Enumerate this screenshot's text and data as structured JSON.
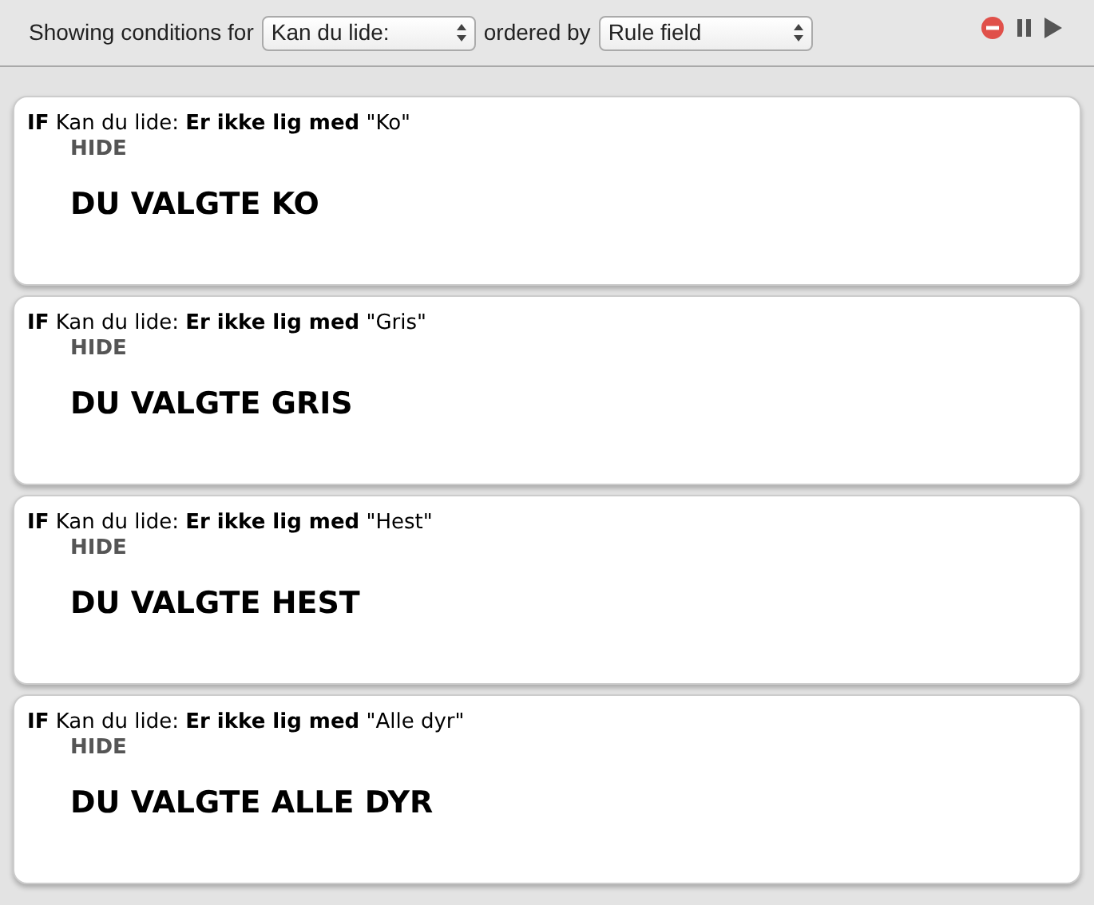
{
  "toolbar": {
    "label": "Showing conditions for",
    "field_select": "Kan du lide:",
    "order_label": "ordered by",
    "order_select": "Rule field"
  },
  "rules": [
    {
      "condition": "**IF** Kan du lide: **Er ikke lig med** \"Ko\"",
      "action": "HIDE",
      "target": "DU VALGTE KO"
    },
    {
      "condition": "**IF** Kan du lide: **Er ikke lig med** \"Gris\"",
      "action": "HIDE",
      "target": "DU VALGTE GRIS"
    },
    {
      "condition": "**IF** Kan du lide: **Er ikke lig med** \"Hest\"",
      "action": "HIDE",
      "target": "DU VALGTE HEST"
    },
    {
      "condition": "**IF** Kan du lide: **Er ikke lig med** \"Alle dyr\"",
      "action": "HIDE",
      "target": "DU VALGTE ALLE DYR"
    }
  ]
}
